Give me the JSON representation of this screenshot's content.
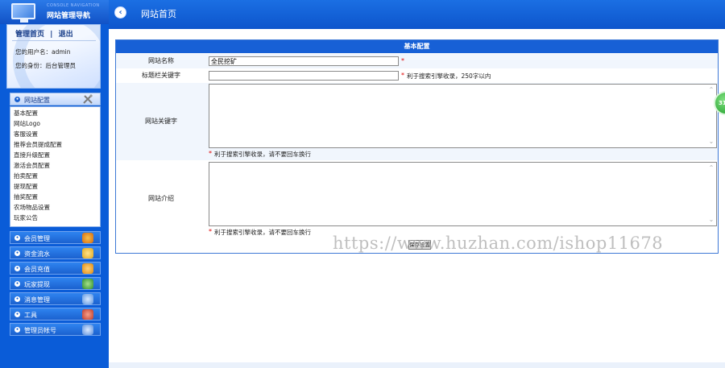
{
  "sidebar": {
    "logo_sub": "CONSOLE NAVIGATION",
    "logo_title": "网站管理导航",
    "user_links": {
      "home": "管理首页",
      "separator": "|",
      "logout": "退出"
    },
    "username_line": "您的用户名：admin",
    "role_line": "您的身份：后台管理员",
    "open_menu": {
      "label": "网站配置",
      "items": [
        "基本配置",
        "网站Logo",
        "客服设置",
        "推荐会员提成配置",
        "直接升级配置",
        "激活会员配置",
        "拍卖配置",
        "提现配置",
        "抽奖配置",
        "农场物品设置",
        "玩家公告"
      ]
    },
    "menus": [
      {
        "label": "会员管理",
        "icon": "members-icon",
        "color": "#f0a020"
      },
      {
        "label": "资金流水",
        "icon": "money-bag-icon",
        "color": "#f3c640"
      },
      {
        "label": "会员充值",
        "icon": "recharge-icon",
        "color": "#f5a623"
      },
      {
        "label": "玩家提现",
        "icon": "withdraw-icon",
        "color": "#3a9a3a"
      },
      {
        "label": "消息管理",
        "icon": "message-icon",
        "color": "#6fa8f0"
      },
      {
        "label": "工具",
        "icon": "tools-icon",
        "color": "#d04a3a"
      },
      {
        "label": "管理员帐号",
        "icon": "admin-account-icon",
        "color": "#6aa0e8"
      }
    ]
  },
  "topbar": {
    "back_icon": "chevron-left-icon",
    "title": "网站首页"
  },
  "form": {
    "header": "基本配置",
    "site_name": {
      "label": "网站名称",
      "value": "全民挖矿",
      "required": "*"
    },
    "seo_title": {
      "label": "标题栏关键字",
      "value": "",
      "required": "*",
      "hint": "利于搜索引擎收录，250字以内"
    },
    "keywords": {
      "label": "网站关键字",
      "value": "",
      "required": "*",
      "hint": "利于搜索引擎收录，请不要回车换行"
    },
    "intro": {
      "label": "网站介绍",
      "value": "",
      "required": "*",
      "hint": "利于搜索引擎收录，请不要回车换行"
    },
    "submit_label": "保存设置"
  },
  "watermark": "https://www.huzhan.com/ishop11678",
  "float_badge": "31"
}
